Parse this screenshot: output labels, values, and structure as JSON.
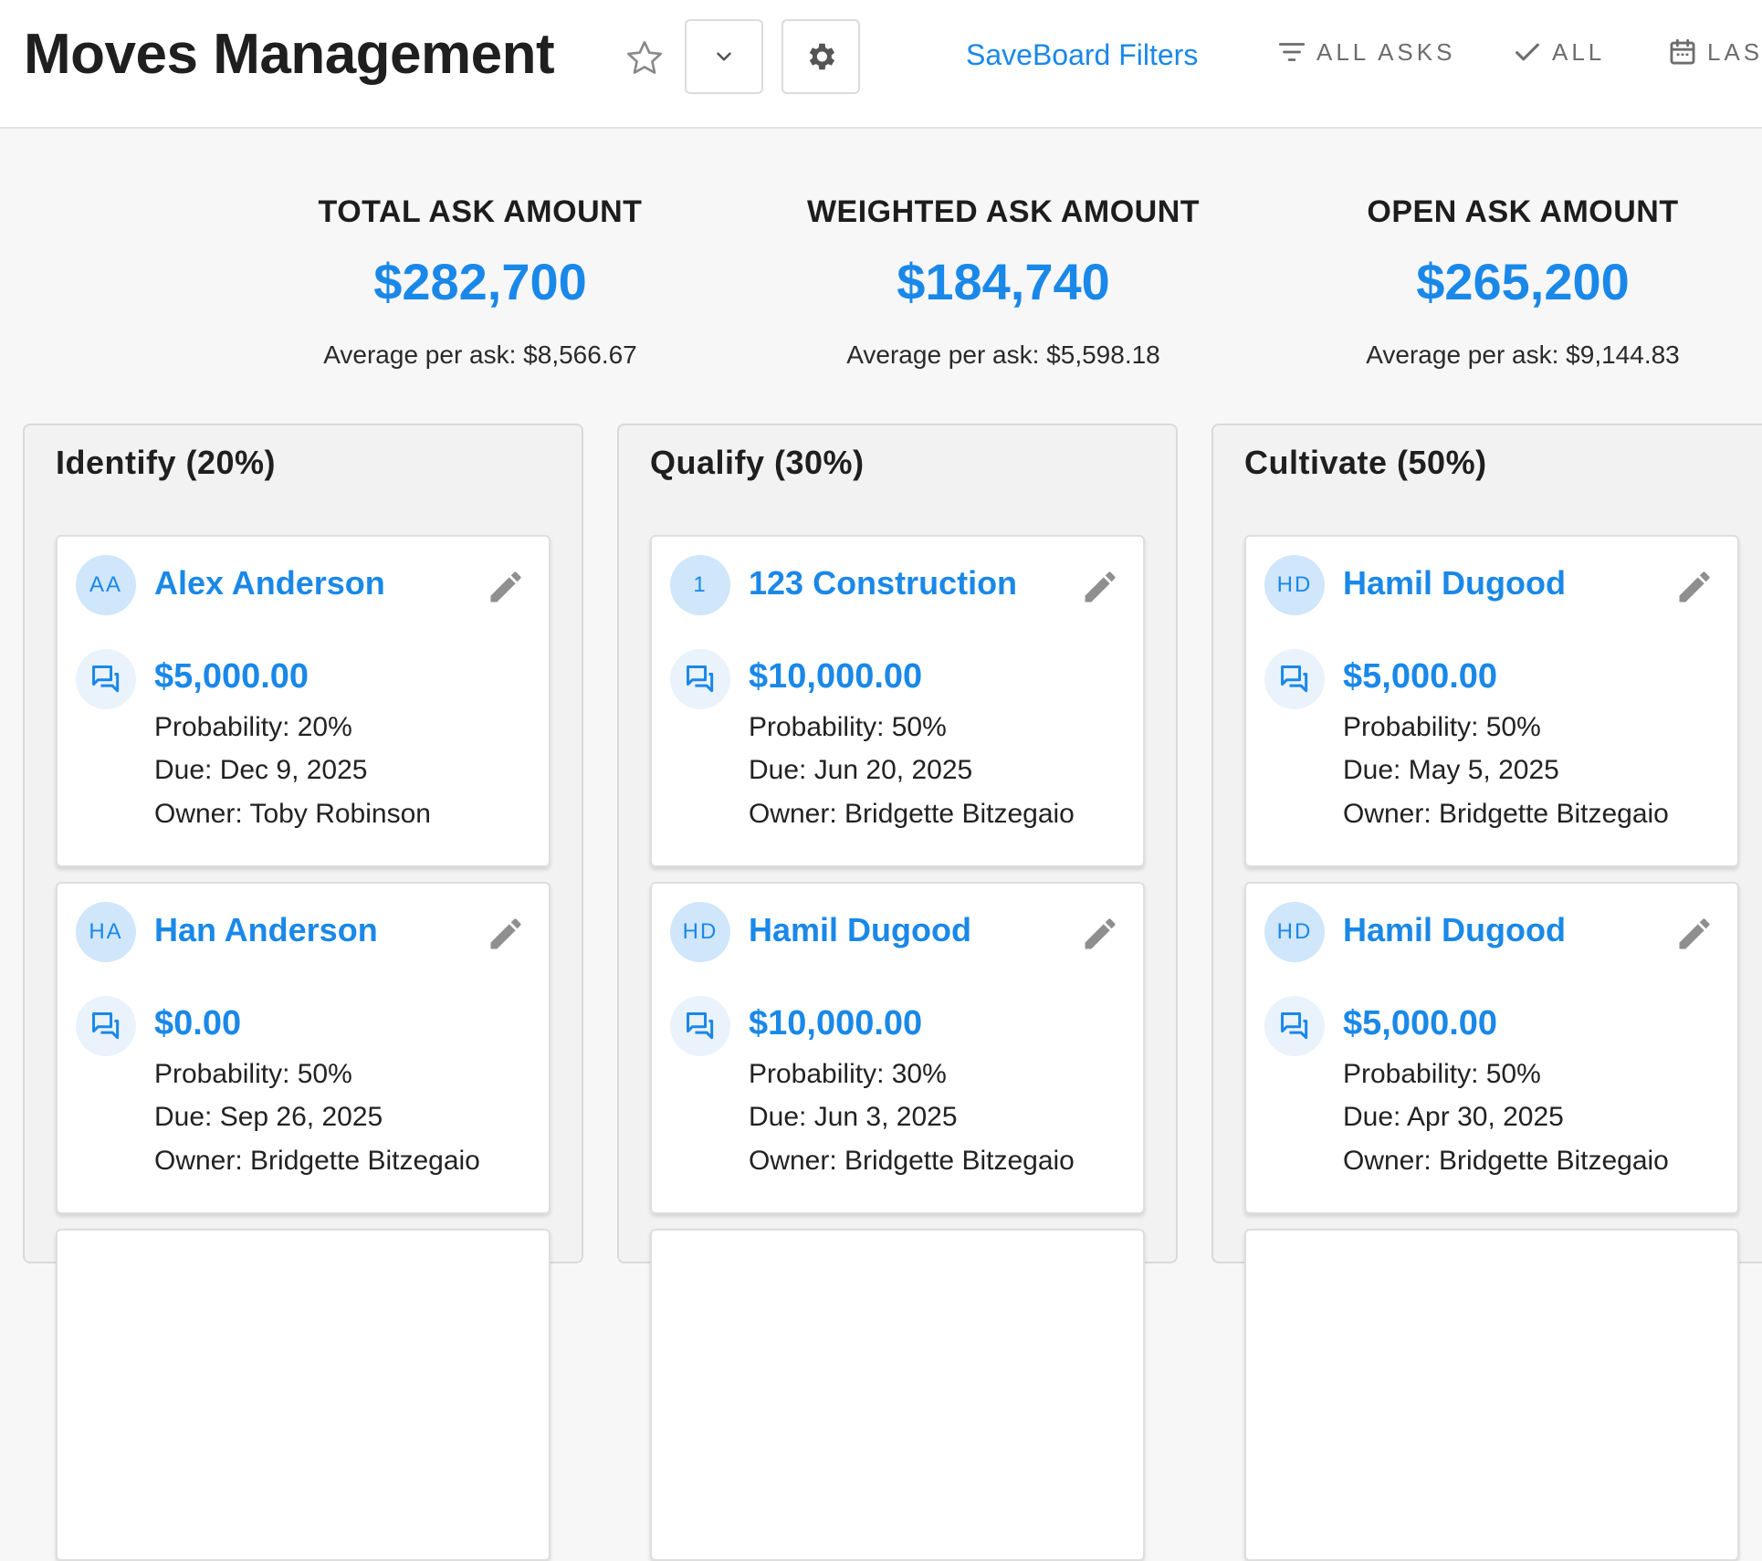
{
  "header": {
    "title": "Moves Management",
    "save_filters_label": "SaveBoard Filters",
    "filter_asks_label": "ALL ASKS",
    "filter_status_label": "ALL",
    "filter_date_label": "LAST"
  },
  "summary": {
    "total": {
      "label": "TOTAL ASK AMOUNT",
      "value": "$282,700",
      "avg": "Average per ask: $8,566.67"
    },
    "weighted": {
      "label": "WEIGHTED ASK AMOUNT",
      "value": "$184,740",
      "avg": "Average per ask: $5,598.18"
    },
    "open": {
      "label": "OPEN ASK AMOUNT",
      "value": "$265,200",
      "avg": "Average per ask: $9,144.83"
    }
  },
  "columns": [
    {
      "title": "Identify (20%)",
      "cards": [
        {
          "initials": "AA",
          "name": "Alex Anderson",
          "amount": "$5,000.00",
          "probability": "Probability: 20%",
          "due": "Due: Dec 9, 2025",
          "owner": "Owner: Toby Robinson"
        },
        {
          "initials": "HA",
          "name": "Han Anderson",
          "amount": "$0.00",
          "probability": "Probability: 50%",
          "due": "Due: Sep 26, 2025",
          "owner": "Owner: Bridgette Bitzegaio"
        }
      ]
    },
    {
      "title": "Qualify (30%)",
      "cards": [
        {
          "initials": "1",
          "name": "123 Construction",
          "amount": "$10,000.00",
          "probability": "Probability: 50%",
          "due": "Due: Jun 20, 2025",
          "owner": "Owner: Bridgette Bitzegaio"
        },
        {
          "initials": "HD",
          "name": "Hamil Dugood",
          "amount": "$10,000.00",
          "probability": "Probability: 30%",
          "due": "Due: Jun 3, 2025",
          "owner": "Owner: Bridgette Bitzegaio"
        }
      ]
    },
    {
      "title": "Cultivate (50%)",
      "cards": [
        {
          "initials": "HD",
          "name": "Hamil Dugood",
          "amount": "$5,000.00",
          "probability": "Probability: 50%",
          "due": "Due: May 5, 2025",
          "owner": "Owner: Bridgette Bitzegaio"
        },
        {
          "initials": "HD",
          "name": "Hamil Dugood",
          "amount": "$5,000.00",
          "probability": "Probability: 50%",
          "due": "Due: Apr 30, 2025",
          "owner": "Owner: Bridgette Bitzegaio"
        }
      ]
    }
  ],
  "icons": {
    "favorite": "star-icon",
    "dropdown": "chevron-down-icon",
    "settings": "gear-icon",
    "filter": "filter-icon",
    "status": "checkmark-icon",
    "date": "calendar-icon",
    "edit": "pencil-icon",
    "ask": "chat-icon"
  },
  "colors": {
    "accent": "#1a88e8",
    "avatar_bg": "#cfe6fb",
    "page_bg": "#f7f7f7"
  }
}
